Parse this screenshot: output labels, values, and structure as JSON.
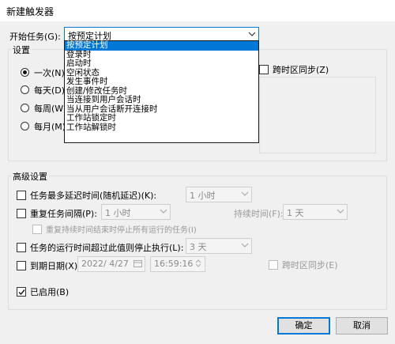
{
  "window": {
    "title": "新建触发器"
  },
  "start_task": {
    "label": "开始任务(G):",
    "selected": "按预定计划",
    "options": [
      "按预定计划",
      "登录时",
      "启动时",
      "空闲状态",
      "发生事件时",
      "创建/修改任务时",
      "当连接到用户会话时",
      "当从用户会话断开连接时",
      "工作站锁定时",
      "工作站解锁时"
    ]
  },
  "settings": {
    "title": "设置",
    "frequency": [
      "一次(N)",
      "每天(D)",
      "每周(W)",
      "每月(M)"
    ],
    "selected_frequency": "一次(N)",
    "timezone_sync_label": "跨时区同步(Z)"
  },
  "advanced": {
    "title": "高级设置",
    "delay": {
      "label": "任务最多延迟时间(随机延迟)(K):",
      "value": "1 小时"
    },
    "repeat": {
      "label": "重复任务间隔(P):",
      "value": "1 小时",
      "duration_label": "持续时间(F):",
      "duration_value": "1 天"
    },
    "stop_running": "重复持续时间结束时停止所有运行的任务(I)",
    "stop_if_longer": {
      "label": "任务的运行时间超过此值则停止执行(L):",
      "value": "3 天"
    },
    "expire": {
      "label": "到期日期(X):",
      "date": "2022/ 4/27",
      "time": "16:59:16",
      "sync_label": "跨时区同步(E)"
    },
    "enabled": "已启用(B)"
  },
  "buttons": {
    "ok": "确定",
    "cancel": "取消"
  }
}
